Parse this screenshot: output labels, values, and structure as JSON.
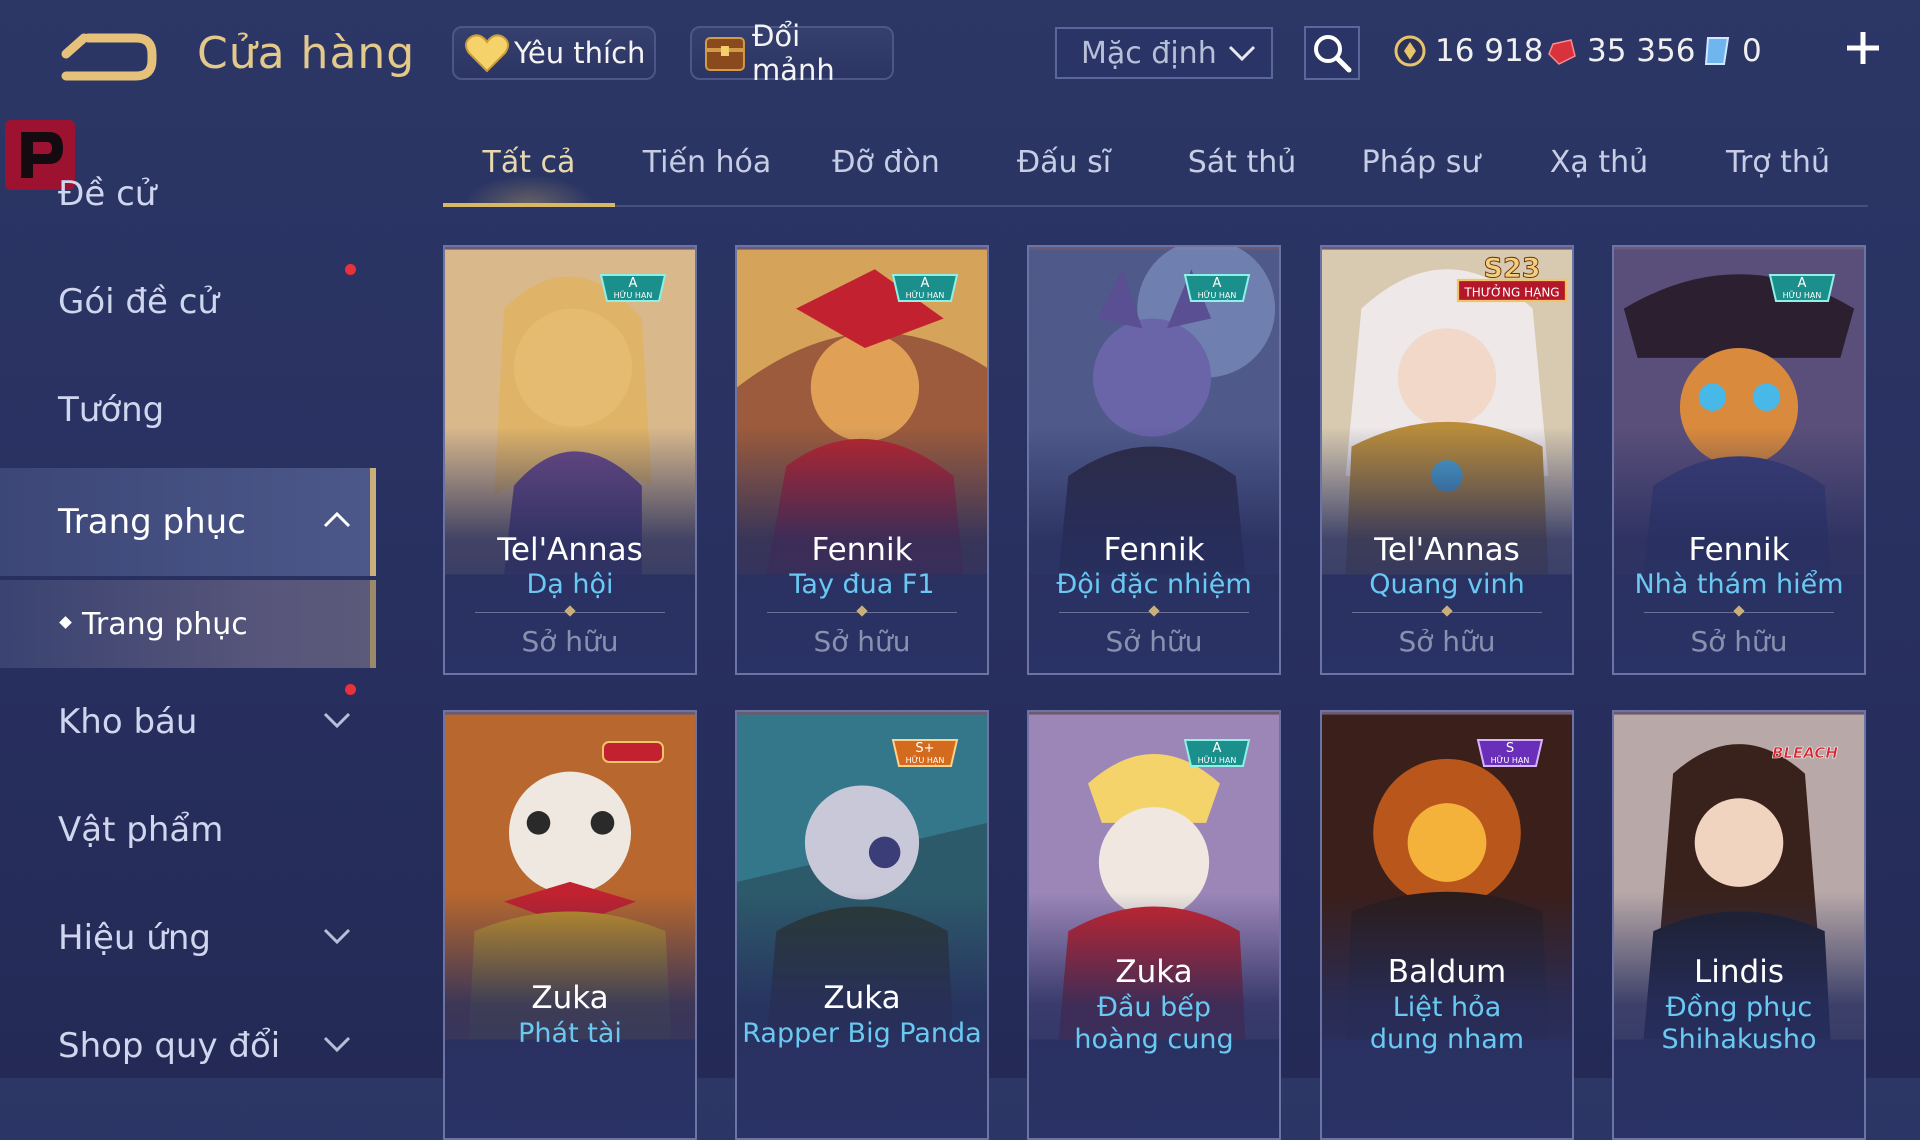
{
  "header": {
    "title": "Cửa hàng",
    "favorites_label": "Yêu thích",
    "fragments_label": "Đổi mảnh",
    "sort_value": "Mặc định",
    "gold": "16 918",
    "ruby": "35 356",
    "voucher": "0"
  },
  "sidebar": {
    "items": [
      {
        "label": "Đề cử"
      },
      {
        "label": "Gói đề cử"
      },
      {
        "label": "Tướng"
      },
      {
        "label": "Trang phục"
      },
      {
        "label": "Trang phục"
      },
      {
        "label": "Kho báu"
      },
      {
        "label": "Vật phẩm"
      },
      {
        "label": "Hiệu ứng"
      },
      {
        "label": "Shop quy đổi"
      }
    ]
  },
  "tabs": [
    "Tất cả",
    "Tiến hóa",
    "Đỡ đòn",
    "Đấu sĩ",
    "Sát thủ",
    "Pháp sư",
    "Xạ thủ",
    "Trợ thủ"
  ],
  "cards": [
    {
      "hero": "Tel'Annas",
      "skin": "Dạ hội",
      "status": "Sở hữu",
      "badge": "A",
      "badge_sub": "HỮU HẠN"
    },
    {
      "hero": "Fennik",
      "skin": "Tay đua F1",
      "status": "Sở hữu",
      "badge": "A",
      "badge_sub": "HỮU HẠN"
    },
    {
      "hero": "Fennik",
      "skin": "Đội đặc nhiệm",
      "status": "Sở hữu",
      "badge": "A",
      "badge_sub": "HỮU HẠN"
    },
    {
      "hero": "Tel'Annas",
      "skin": "Quang vinh",
      "status": "Sở hữu",
      "badge": "S23",
      "badge_sub": "THƯỞNG HẠNG"
    },
    {
      "hero": "Fennik",
      "skin": "Nhà thám hiểm",
      "status": "Sở hữu",
      "badge": "A",
      "badge_sub": "HỮU HẠN"
    },
    {
      "hero": "Zuka",
      "skin": "Phát tài"
    },
    {
      "hero": "Zuka",
      "skin": "Rapper Big Panda",
      "badge": "S+",
      "badge_sub": "HỮU HẠN"
    },
    {
      "hero": "Zuka",
      "skin": "Đầu bếp hoàng cung",
      "badge": "A",
      "badge_sub": "HỮU HẠN"
    },
    {
      "hero": "Baldum",
      "skin": "Liệt hỏa dung nham",
      "badge": "S",
      "badge_sub": "HỮU HẠN"
    },
    {
      "hero": "Lindis",
      "skin": "Đồng phục Shihakusho",
      "badge": "BLEACH"
    }
  ],
  "colors": {
    "accent_gold": "#e3c98a",
    "skin_blue": "#69c9f2",
    "notification": "#e8313c"
  }
}
